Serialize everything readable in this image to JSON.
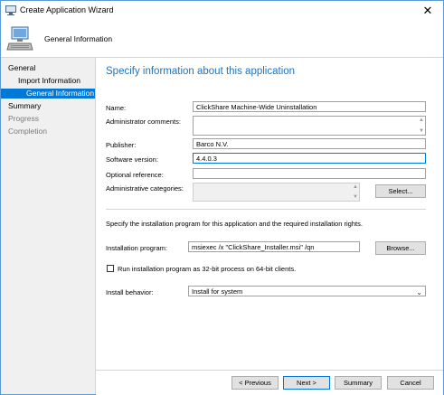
{
  "window": {
    "title": "Create Application Wizard",
    "close_symbol": "✕"
  },
  "header": {
    "title": "General Information"
  },
  "nav": {
    "items": [
      {
        "label": "General"
      },
      {
        "label": "Import Information"
      },
      {
        "label": "General Information"
      },
      {
        "label": "Summary"
      },
      {
        "label": "Progress"
      },
      {
        "label": "Completion"
      }
    ]
  },
  "main": {
    "heading": "Specify information about this application",
    "name_label": "Name:",
    "name_value": "ClickShare Machine-Wide Uninstallation",
    "admin_comments_label": "Administrator comments:",
    "admin_comments_value": "",
    "publisher_label": "Publisher:",
    "publisher_value": "Barco N.V.",
    "software_version_label": "Software version:",
    "software_version_value": "4.4.0.3",
    "optional_reference_label": "Optional reference:",
    "optional_reference_value": "",
    "admin_categories_label": "Administrative categories:",
    "select_button_label": "Select...",
    "install_info_text": "Specify the installation program for this application and the required installation rights.",
    "install_program_label": "Installation program:",
    "install_program_value": "msiexec /x \"ClickShare_Installer.msi\" /qn",
    "browse_button_label": "Browse...",
    "run_32bit_label": "Run installation program as 32-bit process on 64-bit clients.",
    "run_32bit_checked": false,
    "install_behavior_label": "Install behavior:",
    "install_behavior_value": "Install for system"
  },
  "footer": {
    "previous_label": "< Previous",
    "next_label": "Next >",
    "summary_label": "Summary",
    "cancel_label": "Cancel"
  },
  "colors": {
    "accent": "#0078d7",
    "heading": "#1e73be",
    "nav_bg": "#f0f0f0"
  }
}
